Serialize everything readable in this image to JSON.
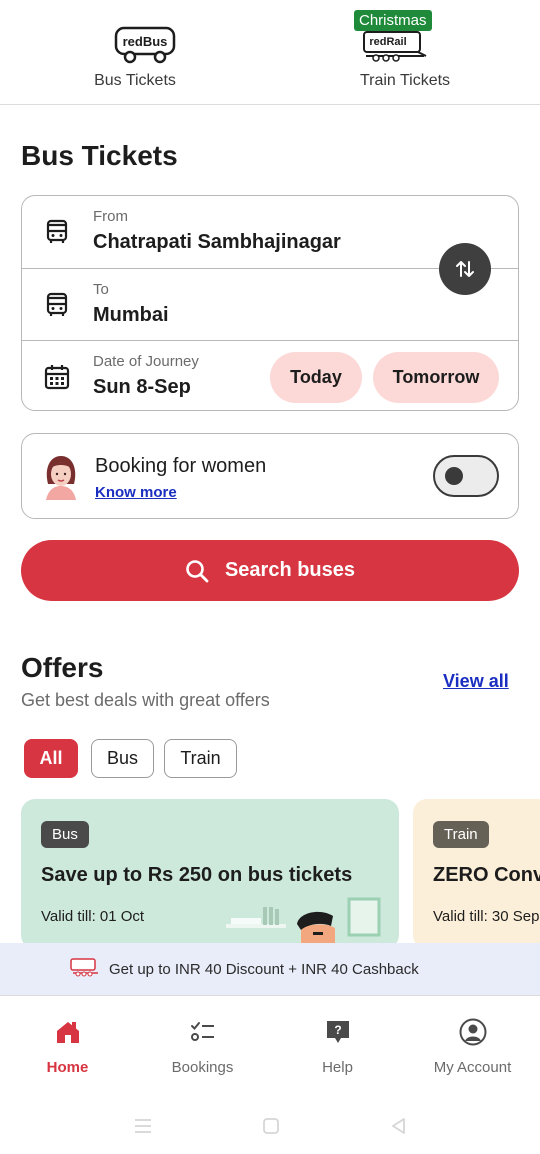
{
  "top_tabs": {
    "bus": {
      "logo_text": "redBus",
      "label": "Bus Tickets"
    },
    "train": {
      "badge": "Christmas",
      "logo_text": "redRail",
      "label": "Train Tickets"
    }
  },
  "page_title": "Bus Tickets",
  "search": {
    "from": {
      "caption": "From",
      "value": "Chatrapati Sambhajinagar",
      "icon": "bus-icon"
    },
    "to": {
      "caption": "To",
      "value": "Mumbai",
      "icon": "bus-icon"
    },
    "date": {
      "caption": "Date of Journey",
      "value": "Sun 8-Sep",
      "icon": "calendar-icon"
    },
    "today_label": "Today",
    "tomorrow_label": "Tomorrow",
    "swap_icon": "swap-arrows-icon"
  },
  "women": {
    "title": "Booking for women",
    "link": "Know more",
    "toggle_on": false
  },
  "search_button": {
    "label": "Search buses",
    "icon": "search-icon"
  },
  "offers": {
    "title": "Offers",
    "subtitle": "Get best deals with great offers",
    "view_all": "View all",
    "filters": [
      "All",
      "Bus",
      "Train"
    ],
    "active_filter": "All",
    "cards": [
      {
        "tag": "Bus",
        "headline": "Save up to Rs 250 on bus tickets",
        "valid": "Valid till: 01 Oct"
      },
      {
        "tag": "Train",
        "headline": "ZERO Conv",
        "valid": "Valid till: 30 Sep"
      }
    ]
  },
  "promo": {
    "text": "Get up to INR 40 Discount + INR 40 Cashback"
  },
  "bottom_nav": [
    {
      "label": "Home",
      "icon": "home-icon",
      "active": true
    },
    {
      "label": "Bookings",
      "icon": "list-icon",
      "active": false
    },
    {
      "label": "Help",
      "icon": "help-icon",
      "active": false
    },
    {
      "label": "My Account",
      "icon": "account-icon",
      "active": false
    }
  ],
  "colors": {
    "brand": "#d73542",
    "chip": "#fcd9d7",
    "link": "#1a2ec0",
    "badge": "#1e8a3a"
  }
}
